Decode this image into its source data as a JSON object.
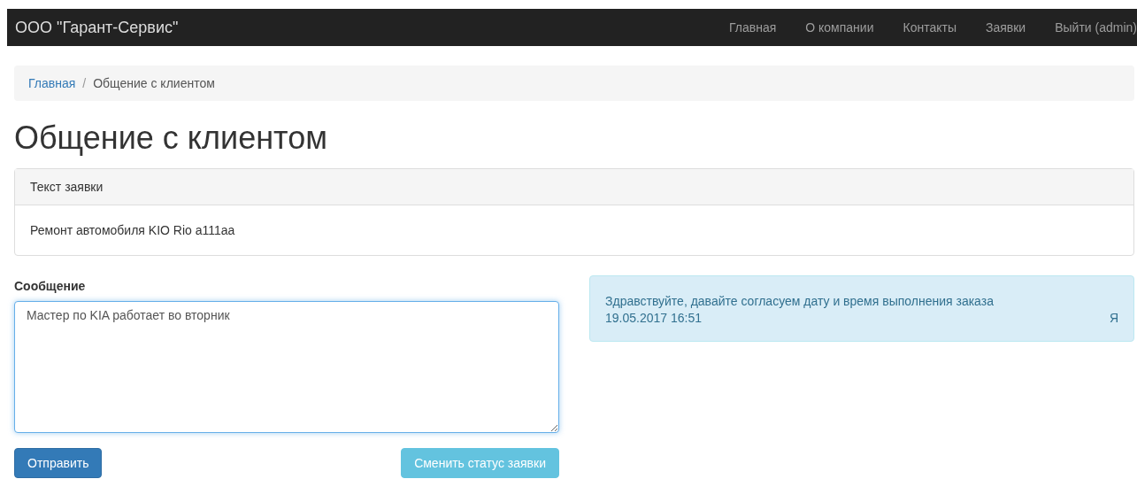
{
  "navbar": {
    "brand": "ООО \"Гарант-Сервис\"",
    "links": [
      {
        "label": "Главная",
        "selected": false
      },
      {
        "label": "О компании",
        "selected": false
      },
      {
        "label": "Контакты",
        "selected": false
      },
      {
        "label": "Заявки",
        "selected": false
      },
      {
        "label": "Выйти (admin)",
        "selected": false
      }
    ]
  },
  "breadcrumb_separator": "/",
  "breadcrumb": [
    {
      "label": "Главная",
      "kind": "link"
    },
    {
      "label": "Общение с клиентом",
      "kind": "current"
    }
  ],
  "heading": "Общение с клиентом",
  "request_panel": {
    "title": "Текст заявки",
    "body": "Ремонт автомобиля KIO Rio a111aa"
  },
  "message_form": {
    "label": "Сообщение",
    "value": "Мастер по KIA работает во вторник ",
    "buttons": [
      {
        "label": "Отправить",
        "kind": "primary"
      },
      {
        "label": "Сменить статус заявки",
        "kind": "info"
      }
    ]
  },
  "messages": [
    {
      "text": "Здравствуйте, давайте согласуем дату и время выполнения заказа",
      "time": "19.05.2017 16:51",
      "author": "Я"
    }
  ]
}
